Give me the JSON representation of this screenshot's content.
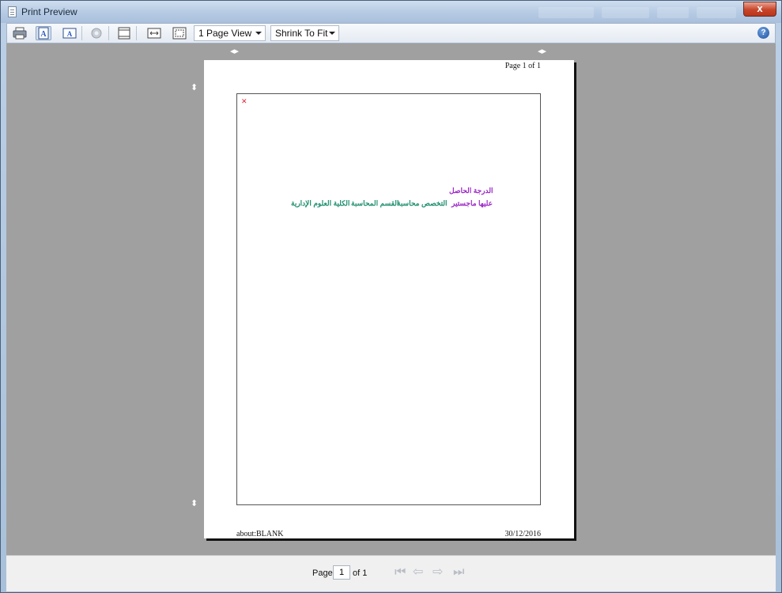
{
  "window": {
    "title": "Print Preview",
    "close": "x"
  },
  "toolbar": {
    "page_view": "1 Page View",
    "fit": "Shrink To Fit",
    "help": "?",
    "icons": [
      "printer-icon",
      "landscape-icon",
      "portrait-icon",
      "page-setup-icon",
      "header-footer-icon",
      "full-width-icon",
      "full-page-icon",
      "help-icon"
    ]
  },
  "page": {
    "header_right": "Page 1 of 1",
    "footer_left": "about:BLANK",
    "footer_right": "30/12/2016",
    "arabic_line1": "الدرجة الحاصل",
    "arabic_line2_1": "عليها ماجستير",
    "arabic_line2_2": "التخصص محاسبة",
    "arabic_line2_3": "القسم المحاسبة",
    "arabic_line2_4": "الكلية العلوم الإدارية",
    "colors": {
      "purple": "#9b27c6",
      "teal": "#1e8f6f"
    }
  },
  "status": {
    "page_label": "Page",
    "page_value": "1",
    "of_label": "of 1"
  }
}
